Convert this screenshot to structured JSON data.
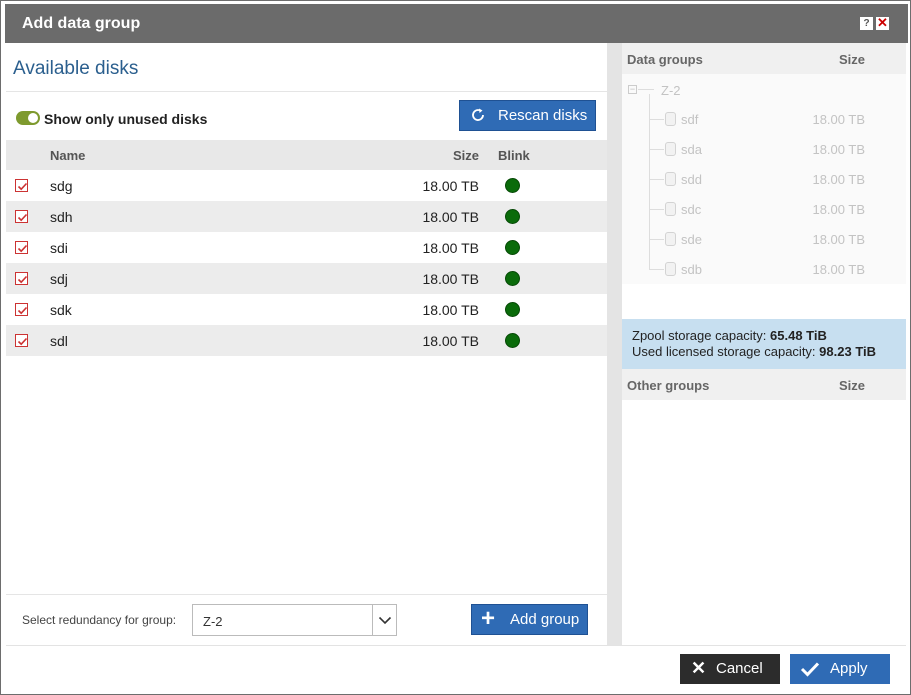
{
  "dialog": {
    "title": "Add data group",
    "help_label": "?",
    "close_label": "✕"
  },
  "available": {
    "title": "Available disks",
    "toggle_label": "Show only unused disks",
    "rescan_label": "Rescan disks",
    "columns": {
      "name": "Name",
      "size": "Size",
      "blink": "Blink"
    },
    "disks": [
      {
        "name": "sdg",
        "size": "18.00 TB",
        "checked": true
      },
      {
        "name": "sdh",
        "size": "18.00 TB",
        "checked": true
      },
      {
        "name": "sdi",
        "size": "18.00 TB",
        "checked": true
      },
      {
        "name": "sdj",
        "size": "18.00 TB",
        "checked": true
      },
      {
        "name": "sdk",
        "size": "18.00 TB",
        "checked": true
      },
      {
        "name": "sdl",
        "size": "18.00 TB",
        "checked": true
      }
    ]
  },
  "redundancy": {
    "label": "Select redundancy for group:",
    "value": "Z-2"
  },
  "add_group_label": "Add group",
  "data_groups": {
    "header": "Data groups",
    "size_header": "Size",
    "group_name": "Z-2",
    "disks": [
      {
        "name": "sdf",
        "size": "18.00 TB"
      },
      {
        "name": "sda",
        "size": "18.00 TB"
      },
      {
        "name": "sdd",
        "size": "18.00 TB"
      },
      {
        "name": "sdc",
        "size": "18.00 TB"
      },
      {
        "name": "sde",
        "size": "18.00 TB"
      },
      {
        "name": "sdb",
        "size": "18.00 TB"
      }
    ]
  },
  "capacity": {
    "zpool_label": "Zpool storage capacity:",
    "zpool_value": "65.48 TiB",
    "licensed_label": "Used licensed storage capacity:",
    "licensed_value": "98.23 TiB"
  },
  "other_groups": {
    "header": "Other groups",
    "size_header": "Size"
  },
  "footer": {
    "cancel_label": "Cancel",
    "apply_label": "Apply"
  },
  "colors": {
    "accent": "#2f6bb5",
    "titlebar": "#6b6b6b",
    "led_on": "#0a6b0a",
    "toggle_on": "#7e9a2e",
    "capacity_bg": "#c7dff0"
  }
}
